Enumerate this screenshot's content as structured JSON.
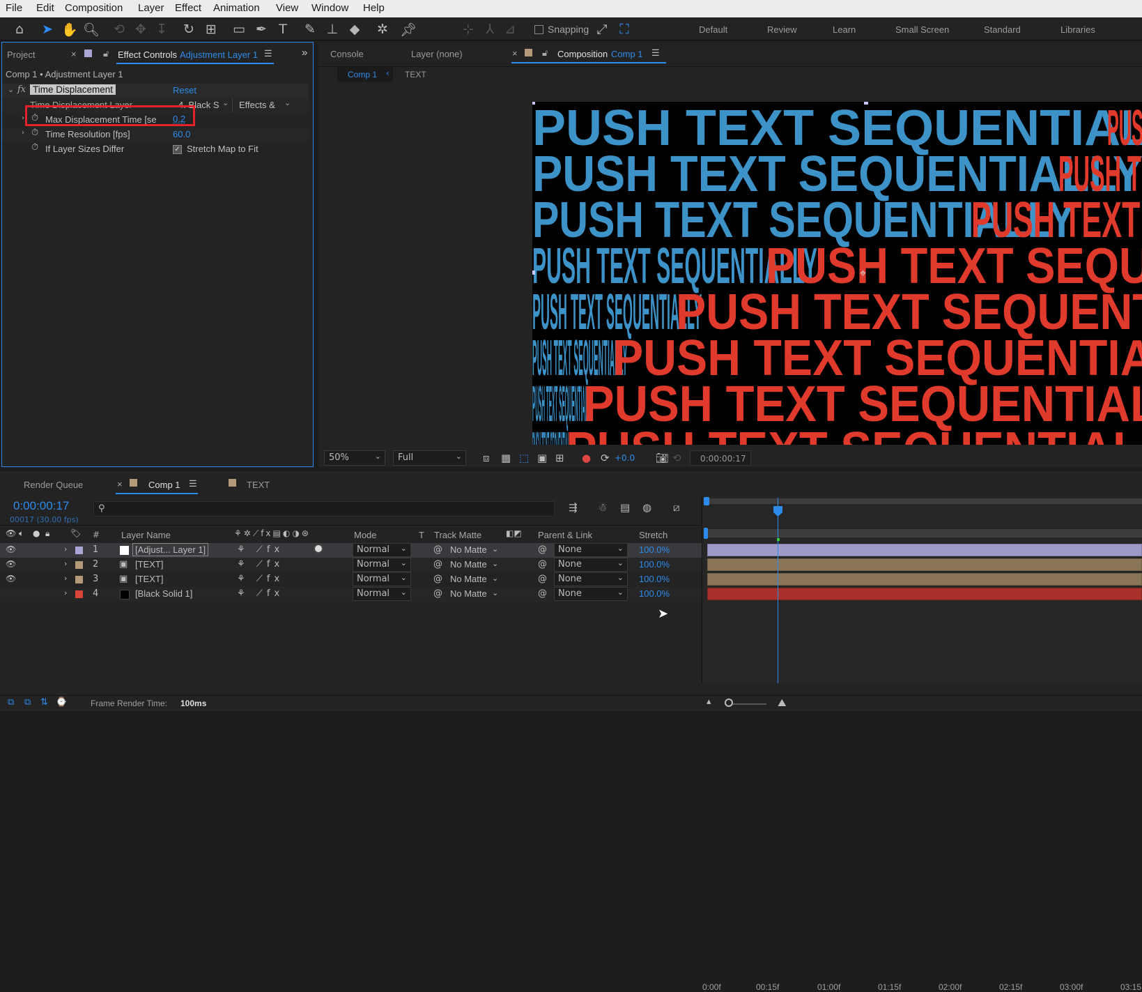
{
  "menu": [
    "File",
    "Edit",
    "Composition",
    "Layer",
    "Effect",
    "Animation",
    "View",
    "Window",
    "Help"
  ],
  "toolbar": {
    "snapping_label": "Snapping",
    "workspaces": [
      "Default",
      "Review",
      "Learn",
      "Small Screen",
      "Standard",
      "Libraries"
    ]
  },
  "left_panel": {
    "tab_project": "Project",
    "tab_effect_controls": "Effect Controls",
    "tab_effect_layer": "Adjustment Layer 1",
    "breadcrumb": "Comp 1 • Adjustment Layer 1",
    "effect_name": "Time Displacement",
    "reset_label": "Reset",
    "params": {
      "layer_label": "Time Displacement Layer",
      "layer_value": "4. Black S",
      "layer_source": "Effects &",
      "max_label": "Max Displacement Time [se",
      "max_value": "0.2",
      "res_label": "Time Resolution [fps]",
      "res_value": "60.0",
      "sizes_label": "If Layer Sizes Differ",
      "sizes_value": "Stretch Map to Fit"
    }
  },
  "viewer": {
    "tab_console": "Console",
    "tab_layer": "Layer (none)",
    "tab_composition": "Composition",
    "tab_comp_name": "Comp 1",
    "flow_comp": "Comp 1",
    "flow_text": "TEXT",
    "canvas_text": "PUSH TEXT SEQUENTIALLY",
    "zoom": "50%",
    "resolution": "Full",
    "exposure": "+0.0",
    "timecode": "0:00:00:17"
  },
  "timeline": {
    "tab_render": "Render Queue",
    "tab_comp": "Comp 1",
    "tab_text": "TEXT",
    "timecode": "0:00:00:17",
    "frame_info": "00017 (30.00 fps)",
    "columns": {
      "hash": "#",
      "layer_name": "Layer Name",
      "mode": "Mode",
      "t": "T",
      "track_matte": "Track Matte",
      "parent": "Parent & Link",
      "stretch": "Stretch"
    },
    "layers": [
      {
        "num": "1",
        "name": "[Adjust... Layer 1]",
        "mode": "Normal",
        "matte": "No Matte",
        "parent": "None",
        "stretch": "100.0%",
        "label_color": "#a9a6d6"
      },
      {
        "num": "2",
        "name": "[TEXT]",
        "mode": "Normal",
        "matte": "No Matte",
        "parent": "None",
        "stretch": "100.0%",
        "label_color": "#b59a7a"
      },
      {
        "num": "3",
        "name": "[TEXT]",
        "mode": "Normal",
        "matte": "No Matte",
        "parent": "None",
        "stretch": "100.0%",
        "label_color": "#b59a7a"
      },
      {
        "num": "4",
        "name": "[Black Solid 1]",
        "mode": "Normal",
        "matte": "No Matte",
        "parent": "None",
        "stretch": "100.0%",
        "label_color": "#d9453a"
      }
    ],
    "ruler": [
      "0:00f",
      "00:15f",
      "01:00f",
      "01:15f",
      "02:00f",
      "02:15f",
      "03:00f",
      "03:15"
    ],
    "render_time_label": "Frame Render Time:",
    "render_time_value": "100ms"
  },
  "colors": {
    "accent": "#2d8ceb",
    "highlight_box": "#e3222a",
    "text_blue": "#3d92c8",
    "text_red": "#e03a2c"
  }
}
